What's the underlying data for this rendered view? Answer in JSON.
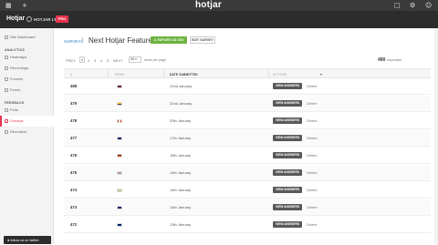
{
  "topbar": {
    "logo": "hotjar",
    "left_icons": [
      "grid-icon",
      "plus-icon"
    ],
    "right_icons": [
      "external-link-icon",
      "gear-icon",
      "user-icon"
    ]
  },
  "brand": {
    "name": "Hotjar",
    "site": "HOTJAR LTD",
    "plan_badge": "PRO"
  },
  "sidebar": {
    "items_top": [
      {
        "label": "Site Dashboard",
        "icon": "dashboard-icon"
      }
    ],
    "analytics_header": "ANALYTICS",
    "analytics": [
      {
        "label": "Heatmaps",
        "icon": "heatmap-icon"
      },
      {
        "label": "Recordings",
        "icon": "recording-icon"
      },
      {
        "label": "Funnels",
        "icon": "funnel-icon"
      },
      {
        "label": "Forms",
        "icon": "form-icon"
      }
    ],
    "feedback_header": "FEEDBACK",
    "feedback": [
      {
        "label": "Polls",
        "icon": "poll-icon"
      },
      {
        "label": "Surveys",
        "icon": "survey-icon",
        "active": true
      },
      {
        "label": "Recruiters",
        "icon": "recruiter-icon"
      }
    ],
    "follow": "follow us on twitter"
  },
  "header": {
    "breadcrumb": "SURVEYS",
    "title": "Next Hotjar Feature",
    "export_label": "EXPORT AS CSV",
    "edit_label": "EDIT SURVEY"
  },
  "pagination": {
    "prev": "PREV",
    "current": "1",
    "pages": [
      "2",
      "3",
      "4",
      "5"
    ],
    "next": "NEXT",
    "per_page_value": "20",
    "per_page_label": "items per page",
    "total_count": "490",
    "total_label": "responses"
  },
  "table": {
    "headers": [
      "#",
      "FROM",
      "DATE SUBMITTED",
      "ACTIONS"
    ],
    "view_label": "VIEW ANSWERS",
    "delete_label": "Delete",
    "rows": [
      {
        "num": "488",
        "flag": "flag-thailand",
        "date": "22nd January"
      },
      {
        "num": "479",
        "flag": "flag-colombia",
        "date": "22nd January"
      },
      {
        "num": "478",
        "flag": "flag-canada",
        "date": "20th January"
      },
      {
        "num": "477",
        "flag": "flag-uk",
        "date": "17th January"
      },
      {
        "num": "476",
        "flag": "flag-germany",
        "date": "15th January"
      },
      {
        "num": "475",
        "flag": "flag-netherlands",
        "date": "14th January"
      },
      {
        "num": "474",
        "flag": "flag-india",
        "date": "14th January"
      },
      {
        "num": "473",
        "flag": "flag-uk",
        "date": "14th January"
      },
      {
        "num": "472",
        "flag": "flag-uk",
        "date": "13th January"
      }
    ]
  },
  "colors": {
    "accent": "#e6334f",
    "export_green": "#6cb33f",
    "topbar": "#3a3a3a",
    "brandbar": "#2c2c2c"
  }
}
